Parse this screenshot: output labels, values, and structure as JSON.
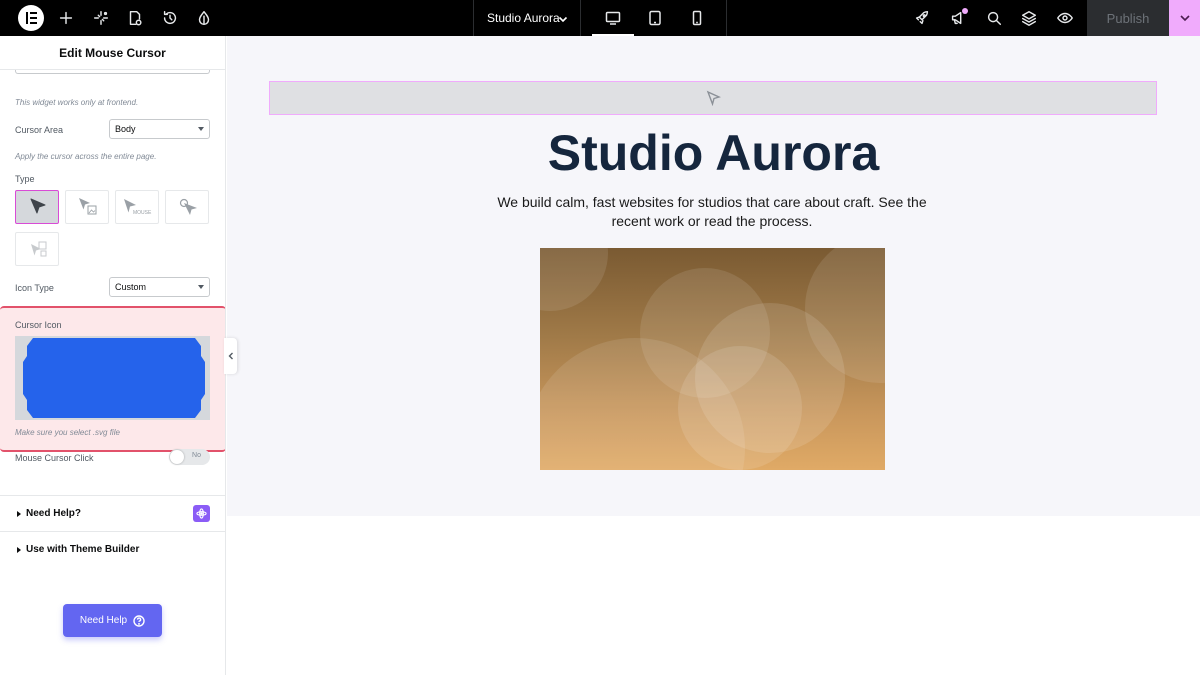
{
  "topbar": {
    "site_title": "Studio Aurora",
    "publish_label": "Publish",
    "icons": [
      "elementor-logo-icon",
      "plus-icon",
      "sparkle-icon",
      "page-settings-icon",
      "history-icon",
      "theme-style-icon",
      "rocket-icon",
      "megaphone-icon",
      "search-icon",
      "layers-icon",
      "preview-eye-icon",
      "chevron-down-icon"
    ],
    "devices": [
      "desktop-icon",
      "tablet-icon",
      "mobile-icon"
    ],
    "active_device": "desktop",
    "colors": {
      "bar": "#000000",
      "publish_accent": "#f0abfc"
    }
  },
  "panel": {
    "title": "Edit Mouse Cursor",
    "frontend_note": "This widget works only at frontend.",
    "cursor_area": {
      "label": "Cursor Area",
      "value": "Body",
      "note": "Apply the cursor across the entire page."
    },
    "type": {
      "label": "Type",
      "tile_icons": [
        "arrow-cursor-icon",
        "arrow-image-cursor-icon",
        "arrow-text-cursor-icon",
        "arrow-circle-cursor-icon",
        "faded-image-cursor-icon"
      ],
      "selected_index": 0,
      "tile_text": "MOUSE"
    },
    "icon_type": {
      "label": "Icon Type",
      "value": "Custom"
    },
    "cursor_icon": {
      "label": "Cursor Icon",
      "note": "Make sure you select .svg file",
      "preview_color": "#2563eb",
      "highlight_color": "#e2526b"
    },
    "mouse_click": {
      "label": "Mouse Cursor Click",
      "toggle_text": "No"
    },
    "accordions": [
      {
        "label": "Need Help?"
      },
      {
        "label": "Use with Theme Builder"
      }
    ],
    "help_button": "Need Help"
  },
  "canvas": {
    "hero_title": "Studio Aurora",
    "hero_text": "We build calm, fast websites for studios that care about craft. See the recent work or read the process.",
    "colors": {
      "title": "#15263d",
      "page_bg": "#f6f6fa",
      "widget_border": "#f0abfc"
    }
  }
}
